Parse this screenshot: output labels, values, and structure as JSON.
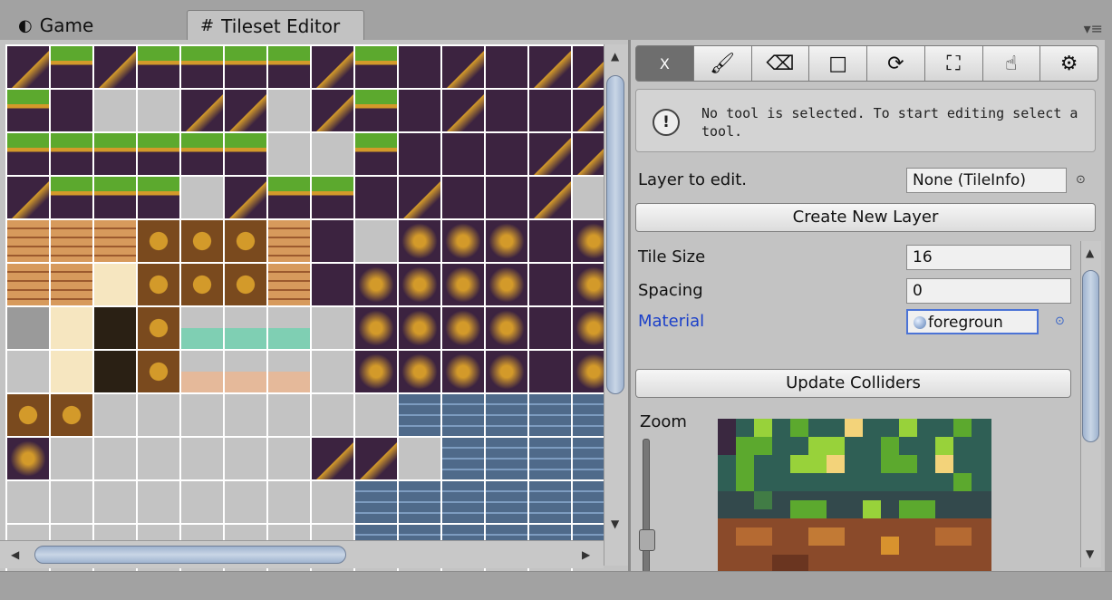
{
  "tabs": [
    {
      "label": "Game",
      "icon": "game-controller-icon"
    },
    {
      "label": "Tileset Editor",
      "icon": "grid-icon"
    }
  ],
  "toolbar": {
    "tools": [
      {
        "name": "deselect",
        "glyph": "X"
      },
      {
        "name": "brush",
        "glyph": "🖌"
      },
      {
        "name": "eraser",
        "glyph": "⌫"
      },
      {
        "name": "rectangle",
        "glyph": "□"
      },
      {
        "name": "refresh",
        "glyph": "⟳"
      },
      {
        "name": "fill",
        "glyph": "⛶"
      },
      {
        "name": "eyedropper",
        "glyph": "☝"
      },
      {
        "name": "settings",
        "glyph": "⚙"
      }
    ]
  },
  "help": {
    "message": "No tool is selected. To start editing select a tool."
  },
  "layer": {
    "label": "Layer to edit.",
    "value": "None (TileInfo)"
  },
  "buttons": {
    "create_layer": "Create New Layer",
    "update_colliders": "Update Colliders"
  },
  "properties": {
    "tile_size_label": "Tile Size",
    "tile_size": "16",
    "spacing_label": "Spacing",
    "spacing": "0",
    "material_label": "Material",
    "material": "foregroun"
  },
  "zoom": {
    "label": "Zoom"
  },
  "colors": {
    "dirt": "#3c2340",
    "gold": "#d39a2a",
    "grass": "#5ca92e",
    "stone": "#4f6a8a",
    "sand": "#f6e6c0",
    "teal": "#2f5f55"
  }
}
